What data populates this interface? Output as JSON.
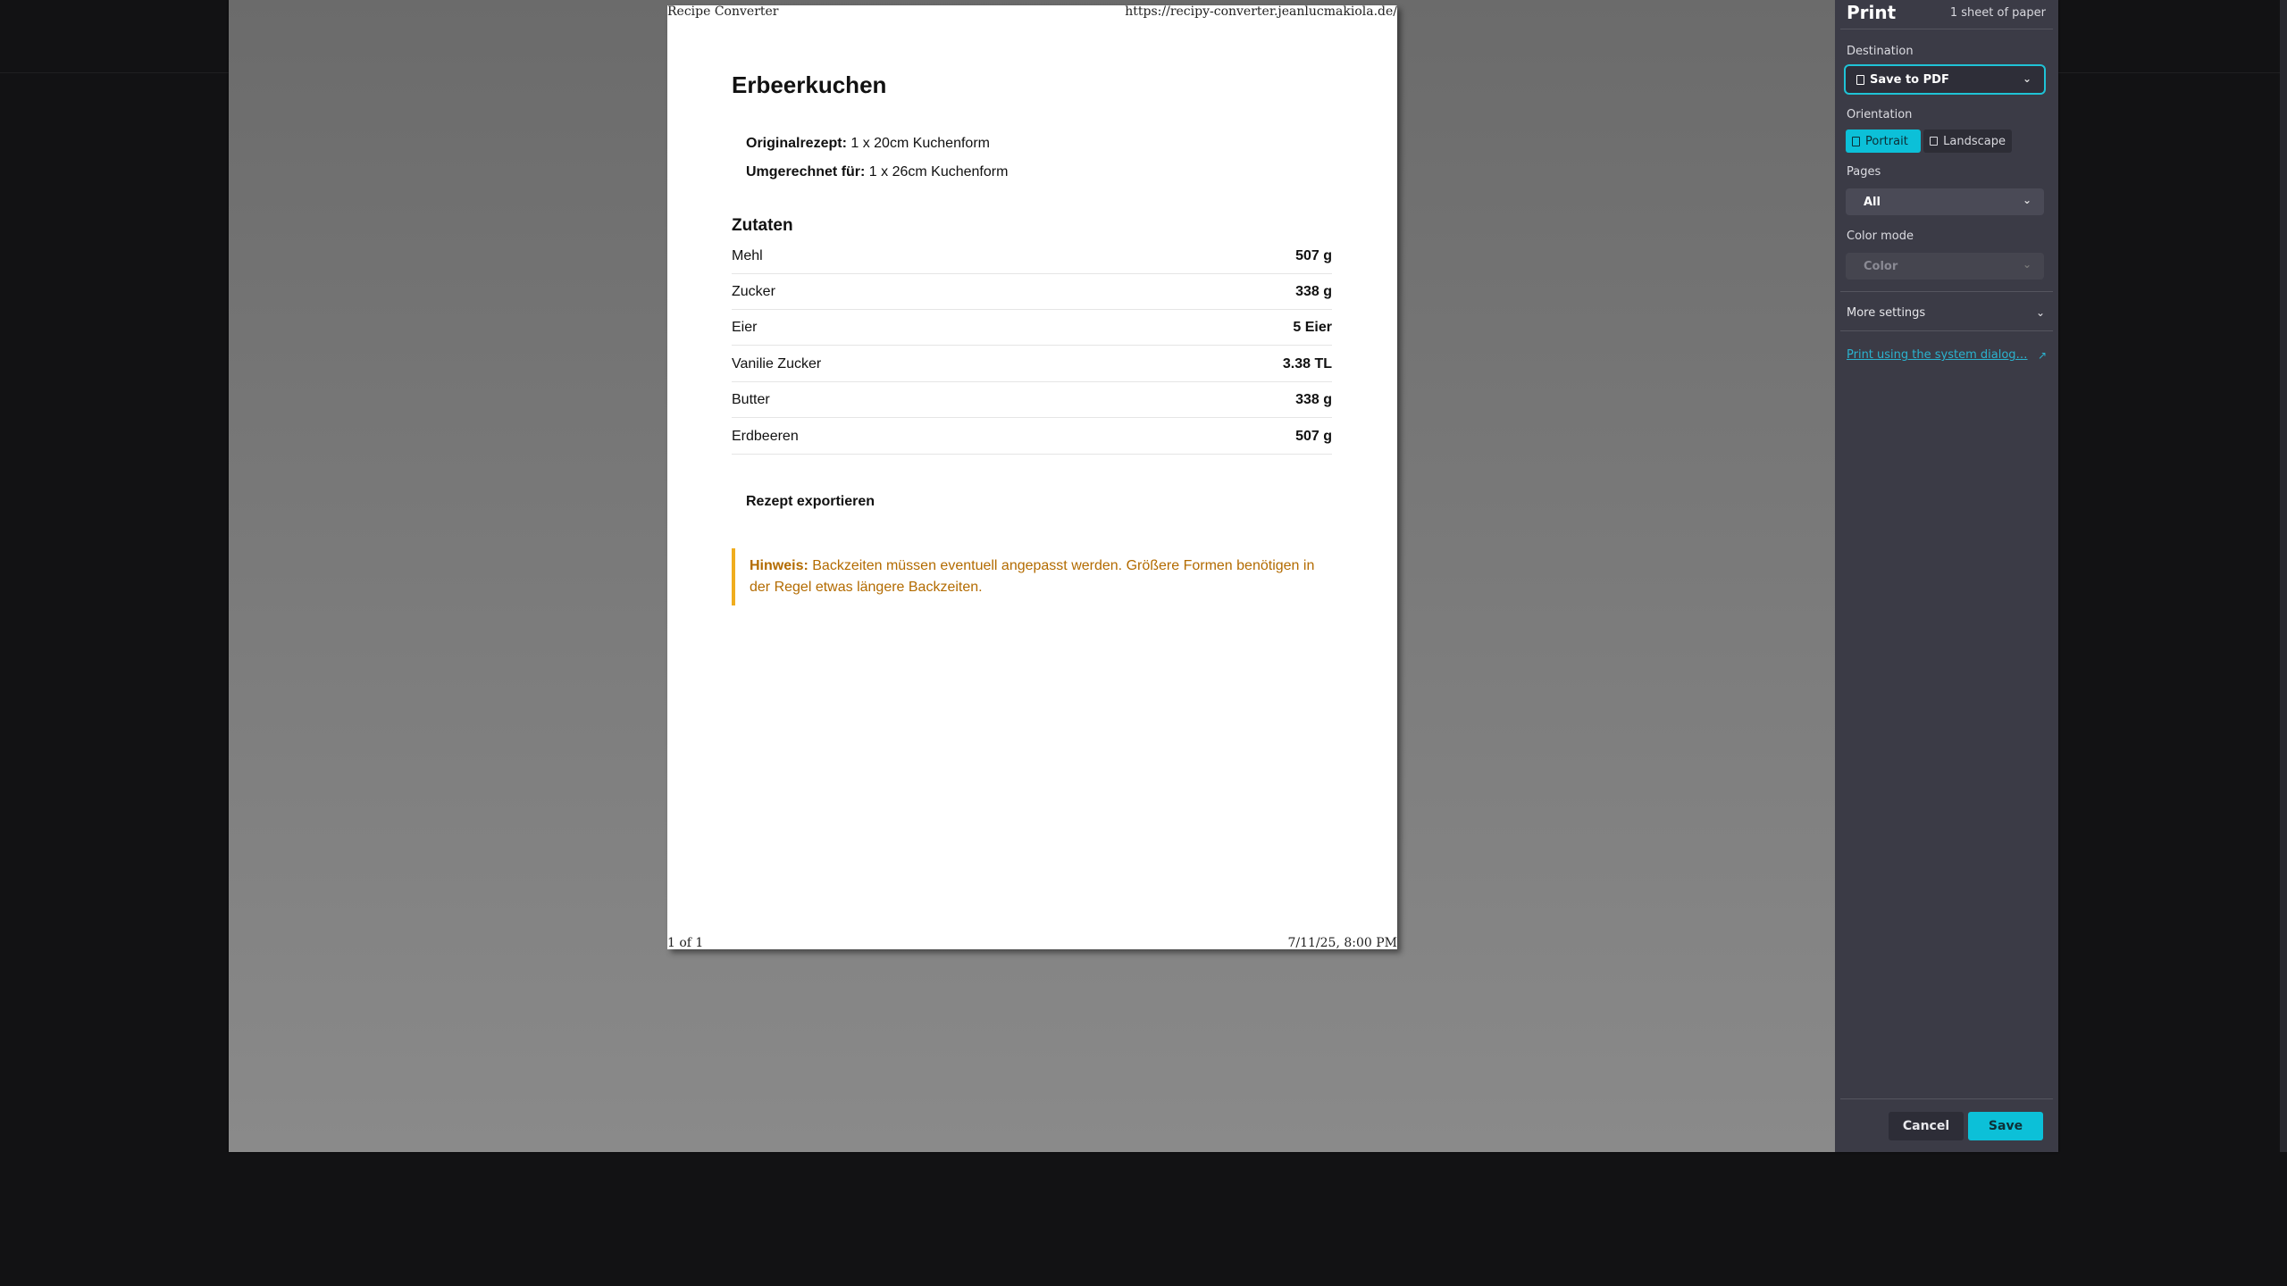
{
  "paper": {
    "header_left": "Recipe Converter",
    "header_right": "https://recipy-converter.jeanlucmakiola.de/",
    "footer_left": "1 of 1",
    "footer_right": "7/11/25, 8:00 PM",
    "recipe_title": "Erbeerkuchen",
    "original_label": "Originalrezept:",
    "original_value": " 1 x 20cm Kuchenform",
    "converted_label": "Umgerechnet für:",
    "converted_value": " 1 x 26cm Kuchenform",
    "ingredients_title": "Zutaten",
    "ingredients": [
      {
        "name": "Mehl",
        "amount": "507 g"
      },
      {
        "name": "Zucker",
        "amount": "338 g"
      },
      {
        "name": "Eier",
        "amount": "5 Eier"
      },
      {
        "name": "Vanilie Zucker",
        "amount": "3.38 TL"
      },
      {
        "name": "Butter",
        "amount": "338 g"
      },
      {
        "name": "Erdbeeren",
        "amount": "507 g"
      }
    ],
    "export_label": "Rezept exportieren",
    "note_label": "Hinweis:",
    "note_text": " Backzeiten müssen eventuell angepasst werden. Größere Formen benötigen in der Regel etwas längere Backzeiten."
  },
  "panel": {
    "title": "Print",
    "sheets": "1 sheet of paper",
    "destination_label": "Destination",
    "destination_value": "Save to PDF",
    "orientation_label": "Orientation",
    "orientation_portrait": "Portrait",
    "orientation_landscape": "Landscape",
    "pages_label": "Pages",
    "pages_value": "All",
    "color_label": "Color mode",
    "color_value": "Color",
    "more_settings": "More settings",
    "system_dialog_link": "Print using the system dialog…",
    "cancel_label": "Cancel",
    "save_label": "Save"
  },
  "colors": {
    "accent": "#0cc0d8",
    "note": "#b36b00",
    "note_border": "#f0ad1e"
  },
  "icons": {
    "chevron": "chevron-down-icon",
    "external": "external-link-icon",
    "document": "document-icon"
  }
}
